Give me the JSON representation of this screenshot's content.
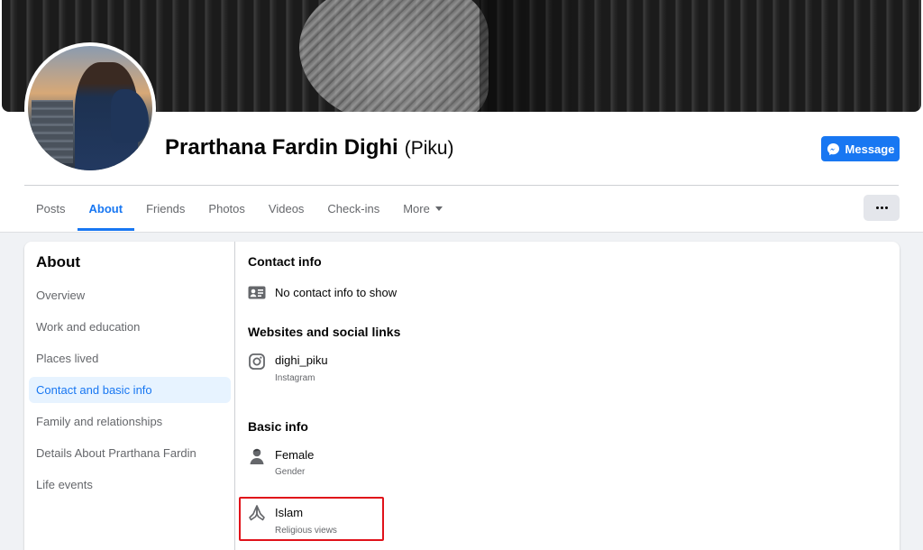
{
  "profile": {
    "name": "Prarthana Fardin Dighi",
    "nickname": "(Piku)",
    "message_button": "Message"
  },
  "tabs": [
    {
      "label": "Posts",
      "active": false
    },
    {
      "label": "About",
      "active": true
    },
    {
      "label": "Friends",
      "active": false
    },
    {
      "label": "Photos",
      "active": false
    },
    {
      "label": "Videos",
      "active": false
    },
    {
      "label": "Check-ins",
      "active": false
    },
    {
      "label": "More",
      "active": false
    }
  ],
  "about": {
    "title": "About",
    "nav": [
      {
        "label": "Overview"
      },
      {
        "label": "Work and education"
      },
      {
        "label": "Places lived"
      },
      {
        "label": "Contact and basic info",
        "active": true
      },
      {
        "label": "Family and relationships"
      },
      {
        "label": "Details About Prarthana Fardin"
      },
      {
        "label": "Life events"
      }
    ]
  },
  "contact": {
    "title": "Contact info",
    "empty_text": "No contact info to show"
  },
  "websites": {
    "title": "Websites and social links",
    "items": [
      {
        "value": "dighi_piku",
        "label": "Instagram",
        "icon": "instagram-icon"
      }
    ]
  },
  "basic": {
    "title": "Basic info",
    "items": [
      {
        "value": "Female",
        "label": "Gender",
        "icon": "gender-icon"
      },
      {
        "value": "Islam",
        "label": "Religious views",
        "icon": "praying-hands-icon"
      }
    ]
  },
  "colors": {
    "accent": "#1877f2",
    "highlight_box": "#e0121a",
    "nav_active_bg": "#e7f3ff"
  }
}
